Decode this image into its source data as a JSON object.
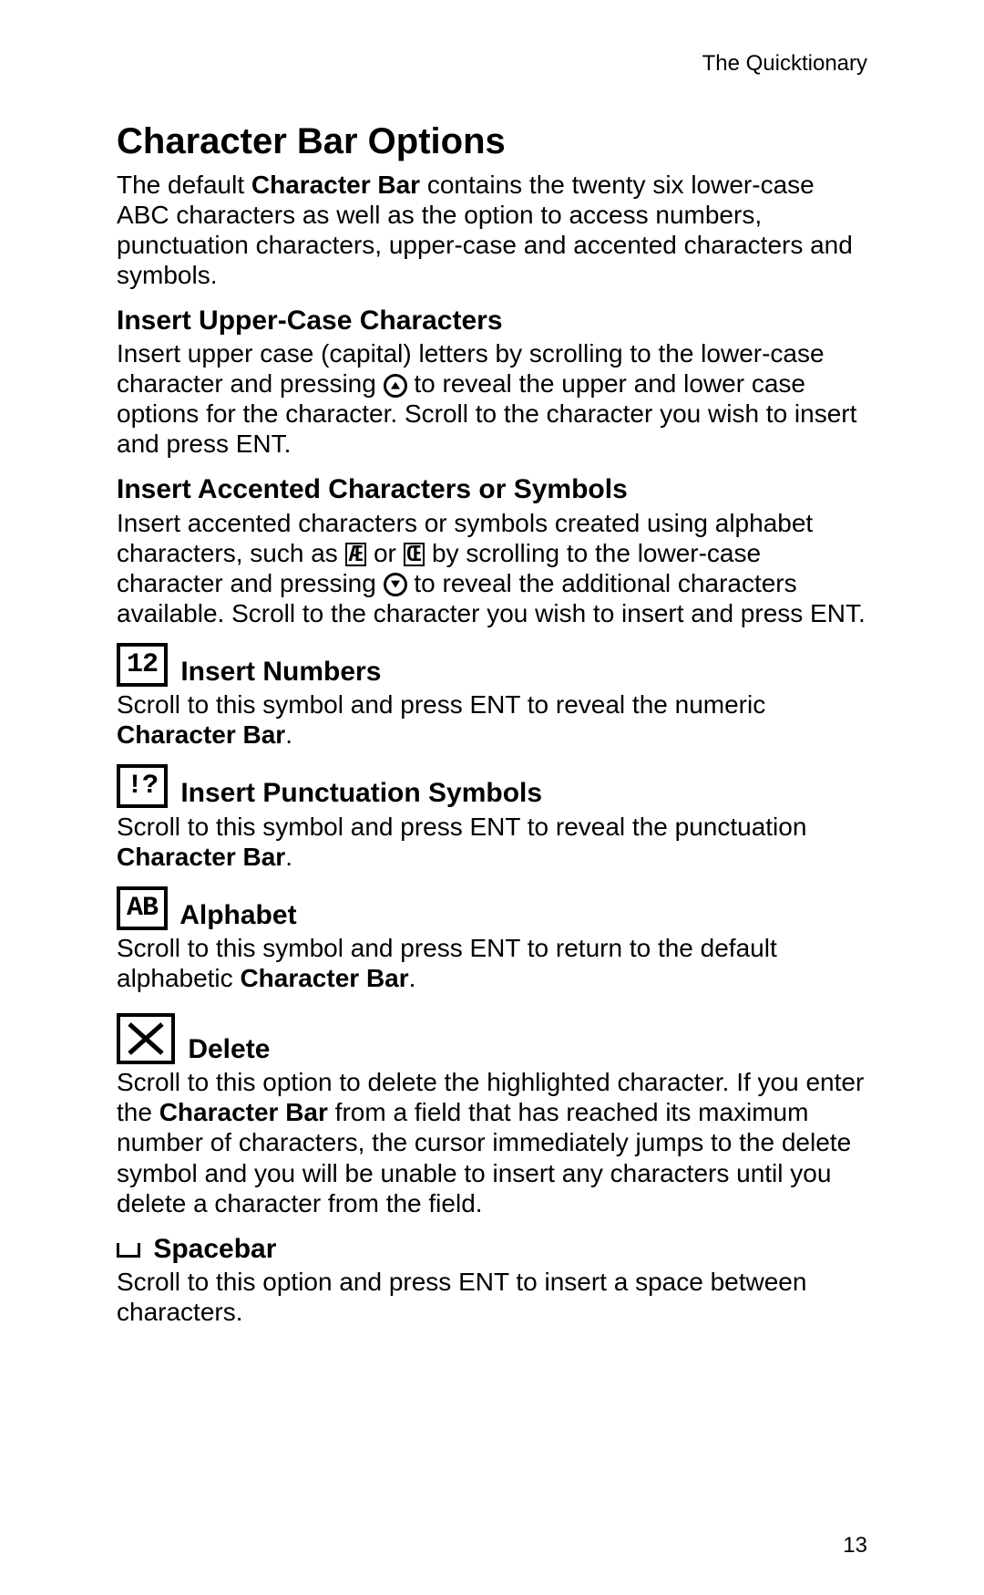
{
  "running_header": "The Quicktionary",
  "title": "Character Bar Options",
  "intro_pre": "The default ",
  "intro_bold": "Character Bar",
  "intro_post": " contains the twenty six lower-case ABC characters as well as the option to access numbers, punctuation characters, upper-case and accented characters and symbols.",
  "sec_upper_title": "Insert Upper-Case Characters",
  "sec_upper_pre": "Insert upper case (capital) letters by scrolling to the lower-case character and pressing ",
  "sec_upper_post": " to reveal the upper and lower case options for the character. Scroll to the character you wish to insert and press ENT.",
  "sec_accent_title": "Insert Accented Characters or Symbols",
  "sec_accent_pre": "Insert accented characters or symbols created using alphabet characters, such as ",
  "sec_accent_or": " or ",
  "sec_accent_mid": " by scrolling to the lower-case character and pressing ",
  "sec_accent_post": " to reveal the additional characters available. Scroll to the character you wish to insert and press ENT.",
  "accent_glyph1": "Æ",
  "accent_glyph2": "Œ",
  "sec_numbers_icon": "12",
  "sec_numbers_title": " Insert Numbers",
  "sec_numbers_body_pre": "Scroll to this symbol and press ENT to reveal the numeric ",
  "sec_numbers_body_bold": "Character Bar",
  "sec_numbers_body_post": ".",
  "sec_punct_icon": "!?",
  "sec_punct_title": " Insert Punctuation Symbols",
  "sec_punct_body_pre": "Scroll to this symbol and press ENT to reveal the punctuation ",
  "sec_punct_body_bold": "Character Bar",
  "sec_punct_body_post": ".",
  "sec_alpha_icon": "AB",
  "sec_alpha_title": " Alphabet",
  "sec_alpha_body_pre": "Scroll to this symbol and press ENT to return to the default alphabetic ",
  "sec_alpha_body_bold": "Character Bar",
  "sec_alpha_body_post": ".",
  "sec_delete_title": " Delete",
  "sec_delete_body_pre": "Scroll to this option to delete the highlighted character. If you enter the ",
  "sec_delete_body_bold": "Character Bar",
  "sec_delete_body_post": " from a field that has reached its maximum number of characters, the cursor immediately jumps to the delete symbol and you will be unable to insert any characters until you delete a character from the field.",
  "sec_space_title": " Spacebar",
  "sec_space_body": "Scroll to this option and press ENT to insert a space between characters.",
  "page_number": "13"
}
